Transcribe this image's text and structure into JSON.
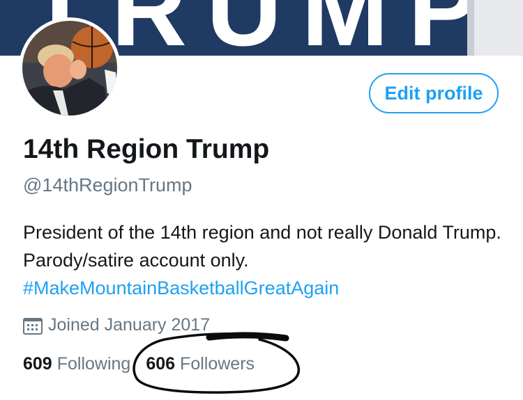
{
  "banner": {
    "text": "TRUMP",
    "color": "#1f3b63"
  },
  "avatar": {
    "icon": "profile-photo"
  },
  "actions": {
    "edit_profile_label": "Edit profile"
  },
  "profile": {
    "name": "14th Region Trump",
    "handle": "@14thRegionTrump",
    "bio_text": "President of the 14th region and not really Donald Trump. Parody/satire account only.",
    "bio_hashtag": "#MakeMountainBasketballGreatAgain",
    "joined": "Joined January 2017"
  },
  "stats": {
    "following_count": "609",
    "following_label": "Following",
    "followers_count": "606",
    "followers_label": "Followers"
  },
  "colors": {
    "accent": "#1da1f2",
    "secondary_text": "#657786",
    "primary_text": "#14171a"
  }
}
